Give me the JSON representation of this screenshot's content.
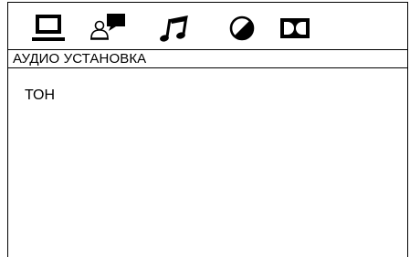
{
  "tabs": [
    {
      "icon": "monitor-icon",
      "active": true
    },
    {
      "icon": "language-speech-icon",
      "active": false
    },
    {
      "icon": "music-note-icon",
      "active": false
    },
    {
      "icon": "video-adjust-icon",
      "active": false
    },
    {
      "icon": "dolby-icon",
      "active": false
    }
  ],
  "page": {
    "title": "АУДИО УСТАНОВКА"
  },
  "menu": {
    "items": [
      {
        "label": "ТОН"
      }
    ]
  },
  "colors": {
    "foreground": "#000000",
    "background": "#ffffff"
  }
}
